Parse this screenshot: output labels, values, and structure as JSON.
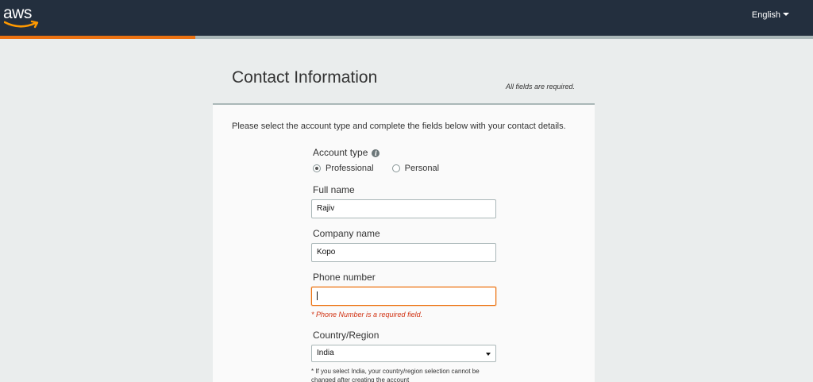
{
  "header": {
    "logo_text": "aws",
    "language": "English"
  },
  "progress": {
    "fraction": 0.24
  },
  "page": {
    "title": "Contact Information",
    "required_note": "All fields are required."
  },
  "form": {
    "intro": "Please select the account type and complete the fields below with your contact details.",
    "account_type": {
      "label": "Account type",
      "options": [
        {
          "label": "Professional",
          "checked": true
        },
        {
          "label": "Personal",
          "checked": false
        }
      ]
    },
    "full_name": {
      "label": "Full name",
      "value": "Rajiv"
    },
    "company_name": {
      "label": "Company name",
      "value": "Kopo"
    },
    "phone_number": {
      "label": "Phone number",
      "value": "",
      "error": "* Phone Number is a required field."
    },
    "country": {
      "label": "Country/Region",
      "value": "India",
      "note": "* If you select India, your country/region selection cannot be changed after creating the account"
    }
  },
  "colors": {
    "header_bg": "#232f3e",
    "accent": "#ec7211",
    "error": "#d13212",
    "page_bg": "#eaeded"
  }
}
